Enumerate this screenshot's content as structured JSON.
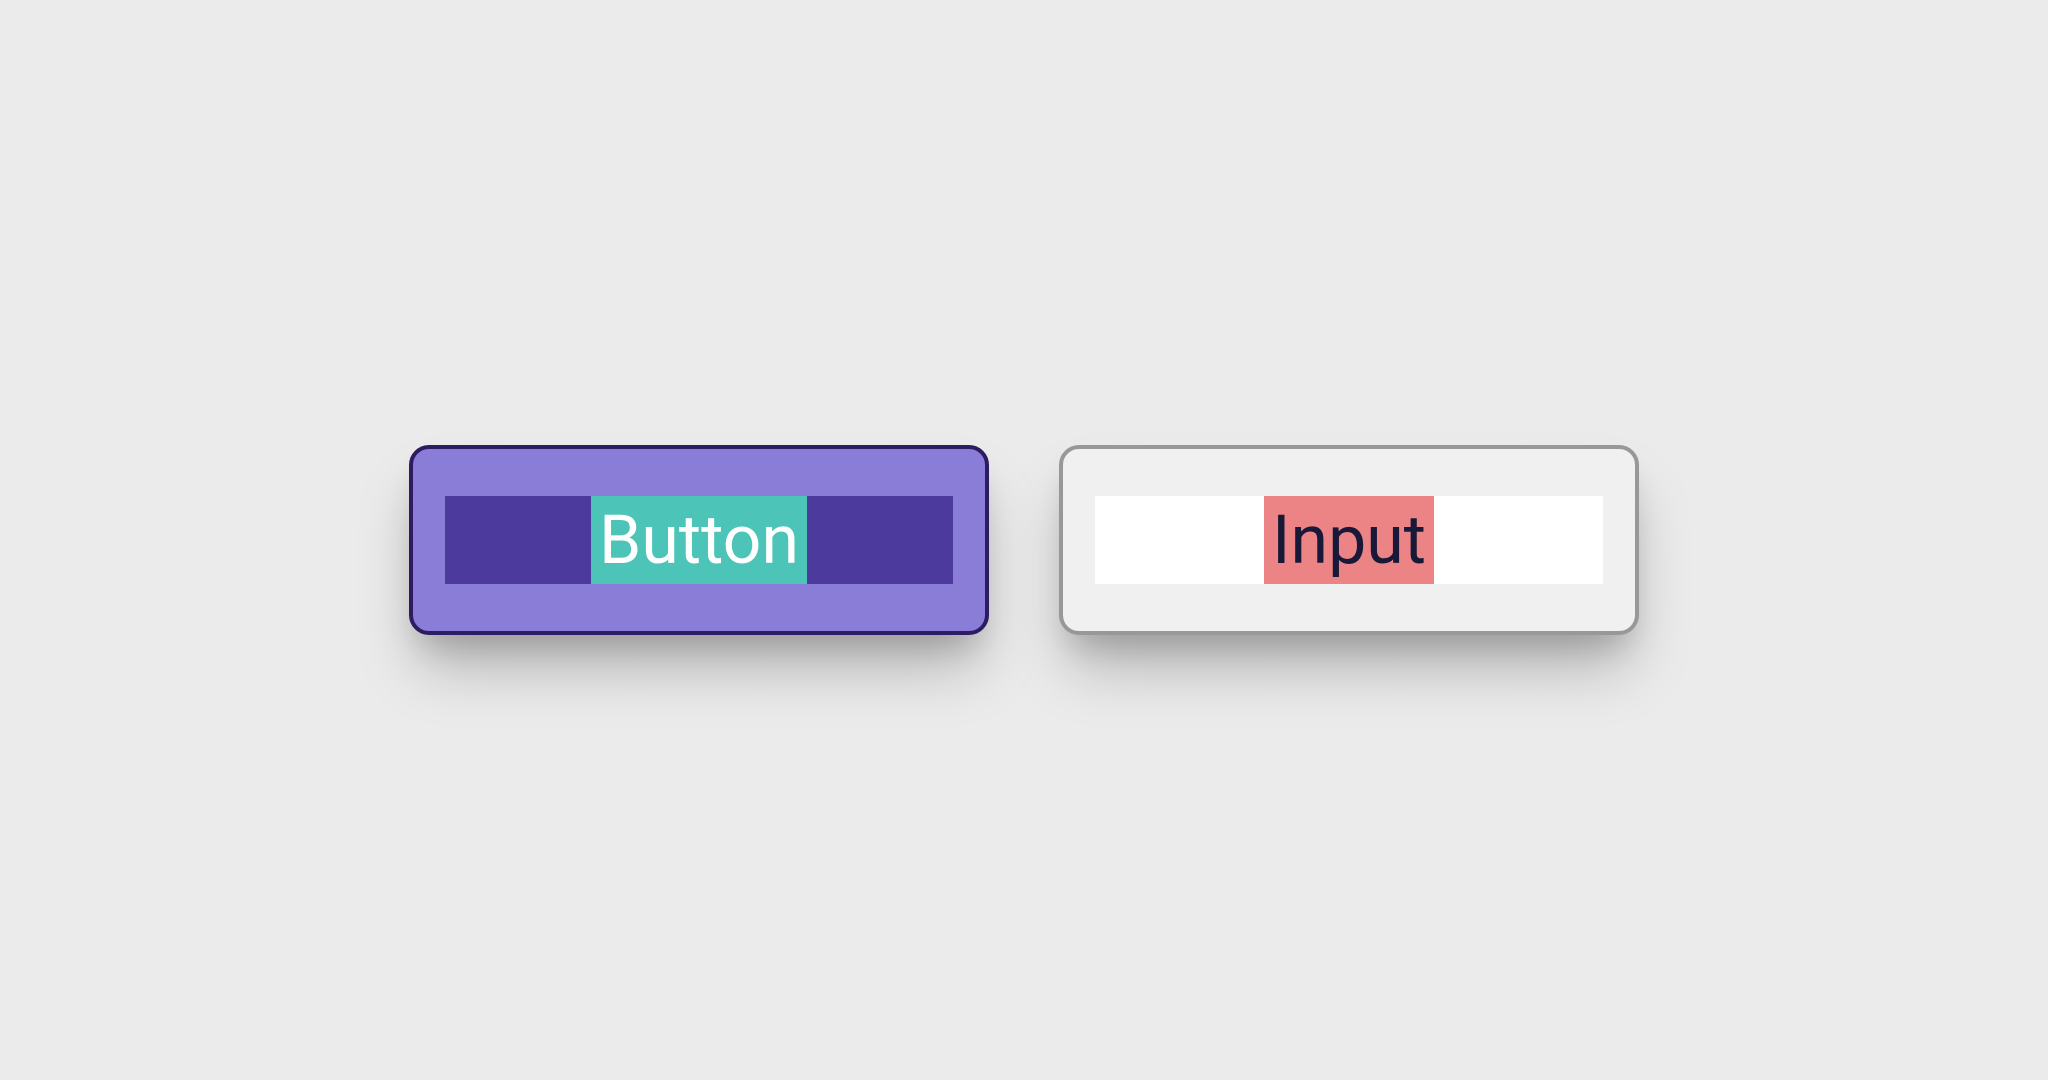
{
  "components": {
    "button": {
      "label": "Button"
    },
    "input": {
      "label": "Input"
    }
  },
  "colors": {
    "button_bg": "#8a7dd8",
    "button_border": "#2d1c61",
    "button_inner": "#4c3a9c",
    "button_highlight": "#4cc4b8",
    "button_text": "#ffffff",
    "input_bg": "#f0f0f0",
    "input_border": "#989898",
    "input_inner": "#ffffff",
    "input_highlight": "#ec8384",
    "input_text": "#181838",
    "page_bg": "#ebebeb"
  }
}
